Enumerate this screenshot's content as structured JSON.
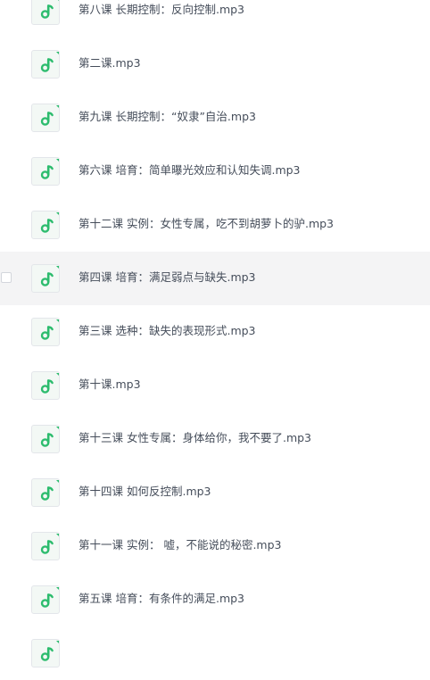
{
  "colors": {
    "icon_accent": "#2dbc6e",
    "hover_background": "#f4f4f5",
    "text": "#454d5a"
  },
  "file_icon": "audio-file-icon",
  "files": [
    {
      "name": "第八课 长期控制：反向控制.mp3"
    },
    {
      "name": "第二课.mp3"
    },
    {
      "name": "第九课 长期控制：“奴隶”自治.mp3"
    },
    {
      "name": "第六课 培育：简单曝光效应和认知失调.mp3"
    },
    {
      "name": "第十二课 实例：女性专属，吃不到胡萝卜的驴.mp3"
    },
    {
      "name": "第四课 培育：满足弱点与缺失.mp3"
    },
    {
      "name": "第三课 选种：缺失的表现形式.mp3"
    },
    {
      "name": "第十课.mp3"
    },
    {
      "name": "第十三课 女性专属：身体给你，我不要了.mp3"
    },
    {
      "name": "第十四课 如何反控制.mp3"
    },
    {
      "name": "第十一课 实例： 嘘，不能说的秘密.mp3"
    },
    {
      "name": "第五课 培育：有条件的满足.mp3"
    },
    {
      "name": ""
    }
  ]
}
